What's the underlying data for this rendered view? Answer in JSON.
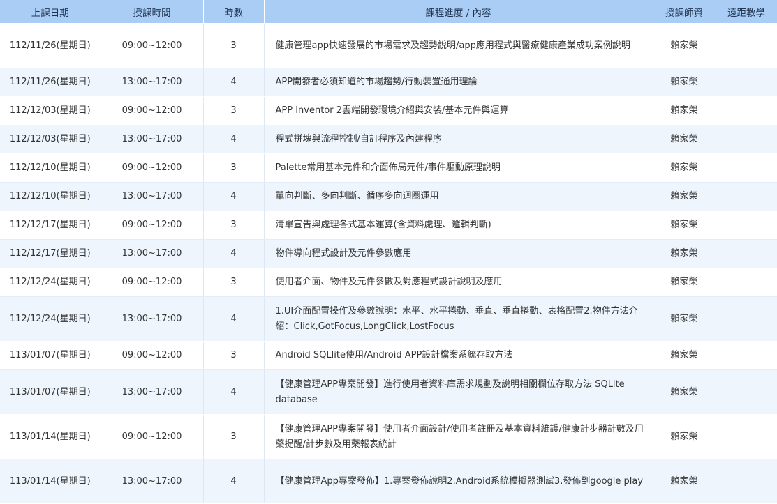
{
  "headers": {
    "date": "上課日期",
    "time": "授課時間",
    "hours": "時數",
    "content": "課程進度 / 內容",
    "teacher": "授課師資",
    "remote": "遠距教學"
  },
  "rows": [
    {
      "date": "112/11/26(星期日)",
      "time": "09:00~12:00",
      "hours": "3",
      "content": "健康管理app快速發展的市場需求及趨勢說明/app應用程式與醫療健康產業成功案例說明",
      "teacher": "賴家榮",
      "remote": "",
      "tall": true
    },
    {
      "date": "112/11/26(星期日)",
      "time": "13:00~17:00",
      "hours": "4",
      "content": "APP開發者必須知道的市場趨勢/行動裝置通用理論",
      "teacher": "賴家榮",
      "remote": "",
      "tall": false
    },
    {
      "date": "112/12/03(星期日)",
      "time": "09:00~12:00",
      "hours": "3",
      "content": "APP Inventor 2雲端開發環境介紹與安裝/基本元件與運算",
      "teacher": "賴家榮",
      "remote": "",
      "tall": false
    },
    {
      "date": "112/12/03(星期日)",
      "time": "13:00~17:00",
      "hours": "4",
      "content": "程式拼塊與流程控制/自訂程序及內建程序",
      "teacher": "賴家榮",
      "remote": "",
      "tall": false
    },
    {
      "date": "112/12/10(星期日)",
      "time": "09:00~12:00",
      "hours": "3",
      "content": "Palette常用基本元件和介面佈局元件/事件驅動原理說明",
      "teacher": "賴家榮",
      "remote": "",
      "tall": false
    },
    {
      "date": "112/12/10(星期日)",
      "time": "13:00~17:00",
      "hours": "4",
      "content": "單向判斷、多向判斷、循序多向迴圈運用",
      "teacher": "賴家榮",
      "remote": "",
      "tall": false
    },
    {
      "date": "112/12/17(星期日)",
      "time": "09:00~12:00",
      "hours": "3",
      "content": "清單宣告與處理各式基本運算(含資料處理、邏輯判斷)",
      "teacher": "賴家榮",
      "remote": "",
      "tall": false
    },
    {
      "date": "112/12/17(星期日)",
      "time": "13:00~17:00",
      "hours": "4",
      "content": "物件導向程式設計及元件參數應用",
      "teacher": "賴家榮",
      "remote": "",
      "tall": false
    },
    {
      "date": "112/12/24(星期日)",
      "time": "09:00~12:00",
      "hours": "3",
      "content": "使用者介面、物件及元件參數及對應程式設計說明及應用",
      "teacher": "賴家榮",
      "remote": "",
      "tall": false
    },
    {
      "date": "112/12/24(星期日)",
      "time": "13:00~17:00",
      "hours": "4",
      "content": "1.UI介面配置操作及參數說明：水平、水平捲動、垂直、垂直捲動、表格配置2.物件方法介紹：Click,GotFocus,LongClick,LostFocus",
      "teacher": "賴家榮",
      "remote": "",
      "tall": true
    },
    {
      "date": "113/01/07(星期日)",
      "time": "09:00~12:00",
      "hours": "3",
      "content": "Android SQLlite使用/Android APP設計檔案系統存取方法",
      "teacher": "賴家榮",
      "remote": "",
      "tall": false
    },
    {
      "date": "113/01/07(星期日)",
      "time": "13:00~17:00",
      "hours": "4",
      "content": "【健康管理APP專案開發】進行使用者資料庫需求規劃及說明相關欄位存取方法 SQLite database",
      "teacher": "賴家榮",
      "remote": "",
      "tall": true
    },
    {
      "date": "113/01/14(星期日)",
      "time": "09:00~12:00",
      "hours": "3",
      "content": "【健康管理APP專案開發】使用者介面設計/使用者註冊及基本資料維護/健康計步器計數及用藥提醒/計步數及用藥報表統計",
      "teacher": "賴家榮",
      "remote": "",
      "tall": true
    },
    {
      "date": "113/01/14(星期日)",
      "time": "13:00~17:00",
      "hours": "4",
      "content": "【健康管理App專案發佈】1.專案發佈說明2.Android系統模擬器測試3.發佈到google play",
      "teacher": "賴家榮",
      "remote": "",
      "tall": true
    }
  ]
}
